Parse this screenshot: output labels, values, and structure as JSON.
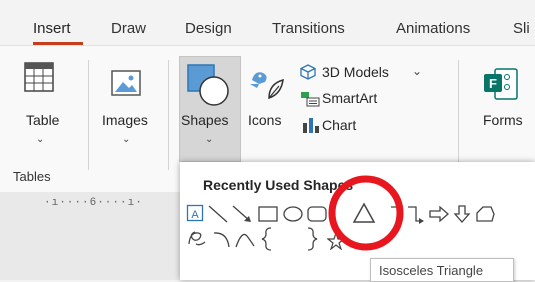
{
  "tabs": [
    {
      "label": "Insert"
    },
    {
      "label": "Draw"
    },
    {
      "label": "Design"
    },
    {
      "label": "Transitions"
    },
    {
      "label": "Animations"
    },
    {
      "label": "Sli"
    }
  ],
  "ribbon": {
    "table_label": "Table",
    "images_label": "Images",
    "shapes_label": "Shapes",
    "icons_label": "Icons",
    "models_label": "3D Models",
    "smartart_label": "SmartArt",
    "chart_label": "Chart",
    "forms_label": "Forms",
    "tables_group_label": "Tables"
  },
  "ruler": {
    "marks": "·ı····6····ı·"
  },
  "shapes_menu": {
    "title": "Recently Used Shapes",
    "tooltip": "Isosceles Triangle"
  },
  "colors": {
    "accent_underline": "#c43e1c",
    "highlight_circle": "#e8161f",
    "selected_button_bg": "#d6d6d6"
  }
}
